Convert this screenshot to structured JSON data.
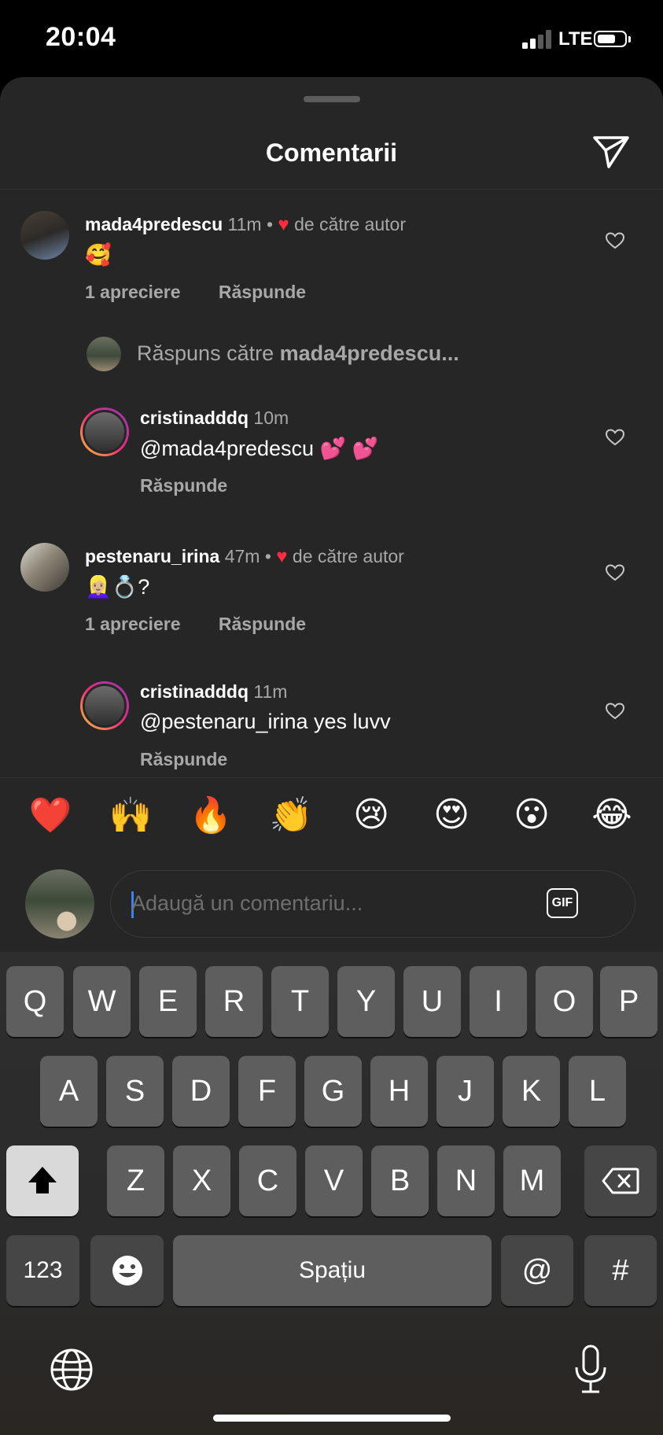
{
  "status_bar": {
    "time": "20:04",
    "network": "LTE",
    "battery_level": 0.6,
    "signal_bars_active": 2
  },
  "sheet": {
    "title": "Comentarii",
    "share_icon": "send-icon"
  },
  "comments": [
    {
      "username": "mada4predescu",
      "time": "11m",
      "separator": "•",
      "author_like": "de către autor",
      "text": "🥰",
      "likes": "1 apreciere",
      "reply": "Răspunde"
    },
    {
      "type": "reply-preview",
      "prefix": "Răspuns către",
      "target": "mada4predescu..."
    },
    {
      "username": "cristinadddq",
      "time": "10m",
      "text": "@mada4predescu 💕 💕",
      "reply": "Răspunde"
    },
    {
      "username": "pestenaru_irina",
      "time": "47m",
      "separator": "•",
      "author_like": "de către autor",
      "text": "👱🏼‍♀️💍?",
      "likes": "1 apreciere",
      "reply": "Răspunde"
    },
    {
      "username": "cristinadddq",
      "time": "11m",
      "text": "@pestenaru_irina yes luvv",
      "reply": "Răspunde"
    }
  ],
  "quick_emojis": [
    "❤️",
    "🙌",
    "🔥",
    "👏",
    "😢",
    "😍",
    "😮",
    "😂"
  ],
  "input": {
    "placeholder": "Adaugă un comentariu...",
    "gif_label": "GIF"
  },
  "keyboard": {
    "row1": [
      "Q",
      "W",
      "E",
      "R",
      "T",
      "Y",
      "U",
      "I",
      "O",
      "P"
    ],
    "row2": [
      "A",
      "S",
      "D",
      "F",
      "G",
      "H",
      "J",
      "K",
      "L"
    ],
    "row3": [
      "Z",
      "X",
      "C",
      "V",
      "B",
      "N",
      "M"
    ],
    "numbers": "123",
    "space": "Spațiu",
    "at": "@",
    "hash": "#"
  }
}
